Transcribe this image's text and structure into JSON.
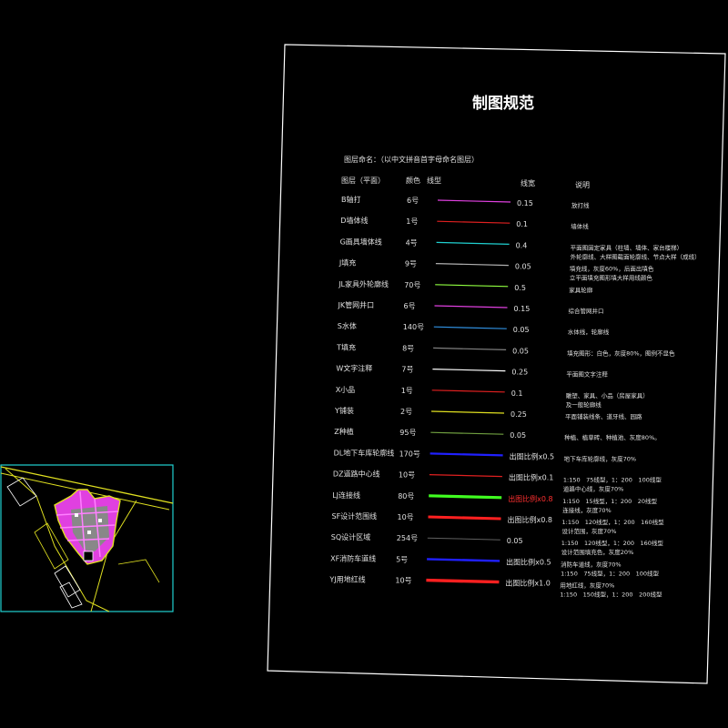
{
  "title": "制图规范",
  "naming_note": "图层命名：（以中文拼音首字母命名图层）",
  "headers": {
    "layer": "图层（平面）",
    "color": "颜色",
    "linetype": "线型",
    "weight": "线宽",
    "usage": "说明"
  },
  "layers": [
    {
      "name": "B轴打",
      "color_no": "6号",
      "stroke": "#e040e0",
      "weight": "0.15",
      "usage": [
        "放打线"
      ]
    },
    {
      "name": "D墙体线",
      "color_no": "1号",
      "stroke": "#e02020",
      "weight": "0.1",
      "usage": [
        "墙体线"
      ]
    },
    {
      "name": "G画具墙体线",
      "color_no": "4号",
      "stroke": "#20d0d0",
      "weight": "0.4",
      "usage": [
        "平面图固定家具（柱墙、墙体、家台楼梯）",
        "外轮廓线、大样图截面轮廓线、节点大样（成线）"
      ]
    },
    {
      "name": "J填充",
      "color_no": "9号",
      "stroke": "#b0b0b0",
      "weight": "0.05",
      "usage": [
        "填充线，灰度60%，后面出填色",
        "立平面填充图形填大样用线颜色"
      ]
    },
    {
      "name": "JL家具外轮廓线",
      "color_no": "70号",
      "stroke": "#90ff40",
      "weight": "0.5",
      "usage": [
        "家具轮廓"
      ]
    },
    {
      "name": "JK管网井口",
      "color_no": "6号",
      "stroke": "#e040e0",
      "weight": "0.15",
      "usage": [
        "综合管网井口"
      ]
    },
    {
      "name": "S水体",
      "color_no": "140号",
      "stroke": "#3090e0",
      "weight": "0.05",
      "usage": [
        "水体线，轮廓线"
      ]
    },
    {
      "name": "T填充",
      "color_no": "8号",
      "stroke": "#808080",
      "weight": "0.05",
      "usage": [
        "填充图形：白色，灰度80%，图例不显色"
      ]
    },
    {
      "name": "W文字注释",
      "color_no": "7号",
      "stroke": "#ffffff",
      "weight": "0.25",
      "usage": [
        "平面图文字注释"
      ]
    },
    {
      "name": "X小品",
      "color_no": "1号",
      "stroke": "#e02020",
      "weight": "0.1",
      "usage": [
        "雕塑、家具、小品（房屋家具）",
        "及一般轮廓线"
      ]
    },
    {
      "name": "Y铺装",
      "color_no": "2号",
      "stroke": "#e0e020",
      "weight": "0.25",
      "usage": [
        "平面铺装线条、道牙线、园路"
      ]
    },
    {
      "name": "Z种植",
      "color_no": "95号",
      "stroke": "#70a040",
      "weight": "0.05",
      "usage": [
        "种植、植草砖、种植池、灰度80%。"
      ]
    },
    {
      "name": "DL地下车库轮廓线",
      "color_no": "170号",
      "stroke": "#2020ff",
      "weight": "出图比例x0.5",
      "usage": [
        "地下车库轮廓线，灰度70%"
      ]
    },
    {
      "name": "DZ道路中心线",
      "color_no": "10号",
      "stroke": "#e02020",
      "weight": "出图比例x0.1",
      "usage": [
        "1:150　75线型，1：200　100线型",
        "道路中心线，灰度70%"
      ]
    },
    {
      "name": "LJ连接线",
      "color_no": "80号",
      "stroke": "#40ff20",
      "weight": "出图比例x0.8",
      "weight_color": "#ff3030",
      "usage": [
        "1:150　15线型，1：200　20线型",
        "连接线，灰度70%"
      ]
    },
    {
      "name": "SF设计范围线",
      "color_no": "10号",
      "stroke": "#ff2020",
      "weight": "出图比例x0.8",
      "usage": [
        "1:150　120线型，1：200　160线型",
        "设计范围，灰度70%"
      ]
    },
    {
      "name": "SQ设计区域",
      "color_no": "254号",
      "stroke": "#606060",
      "weight": "0.05",
      "usage": [
        "1:150　120线型，1：200　160线型",
        "设计范围填充色，灰度20%"
      ]
    },
    {
      "name": "XF消防车道线",
      "color_no": "5号",
      "stroke": "#2020ff",
      "weight": "出图比例x0.5",
      "usage": [
        "消防车道线，灰度70%",
        "1:150　75线型，1：200　100线型"
      ]
    },
    {
      "name": "YJ用地红线",
      "color_no": "10号",
      "stroke": "#ff2020",
      "weight": "出图比例x1.0",
      "usage": [
        "用地红线，灰度70%",
        "1:150　150线型，1：200　200线型"
      ]
    }
  ],
  "colors": {
    "background": "#000000",
    "frame": "#ffffff",
    "viewport": "#20d0d0",
    "plan_fill": "#e040e0",
    "plan_outline": "#e0e020"
  }
}
